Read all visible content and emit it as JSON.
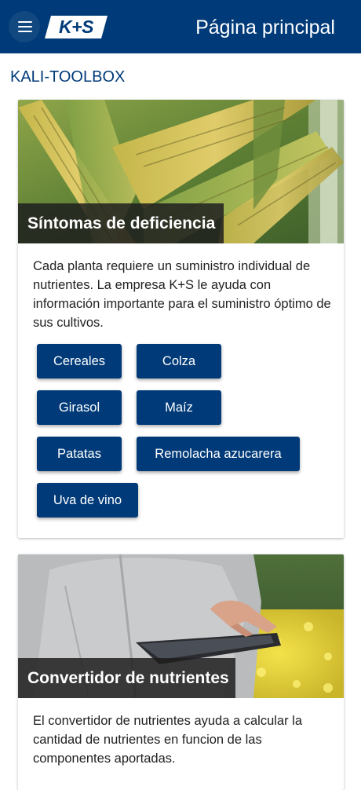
{
  "header": {
    "logo_text": "K+S",
    "title": "Página principal"
  },
  "section": {
    "heading": "KALI-TOOLBOX"
  },
  "cards": [
    {
      "title": "Síntomas de deficiencia",
      "description": "Cada planta requiere un suministro individual de nutrientes. La empresa K+S le ayuda con información importante para el suministro óptimo de sus cultivos.",
      "buttons": [
        "Cereales",
        "Colza",
        "Girasol",
        "Maíz",
        "Patatas",
        "Remolacha azucarera",
        "Uva de vino"
      ]
    },
    {
      "title": "Convertidor de nutrientes",
      "description": "El convertidor de nutrientes ayuda a calcular la cantidad de nutrientes en funcion de las componentes aportadas."
    }
  ],
  "colors": {
    "brand_blue": "#003a78",
    "label_overlay": "#1e1e1e",
    "background": "#ffffff"
  },
  "icons": [
    "menu-icon",
    "logo"
  ]
}
